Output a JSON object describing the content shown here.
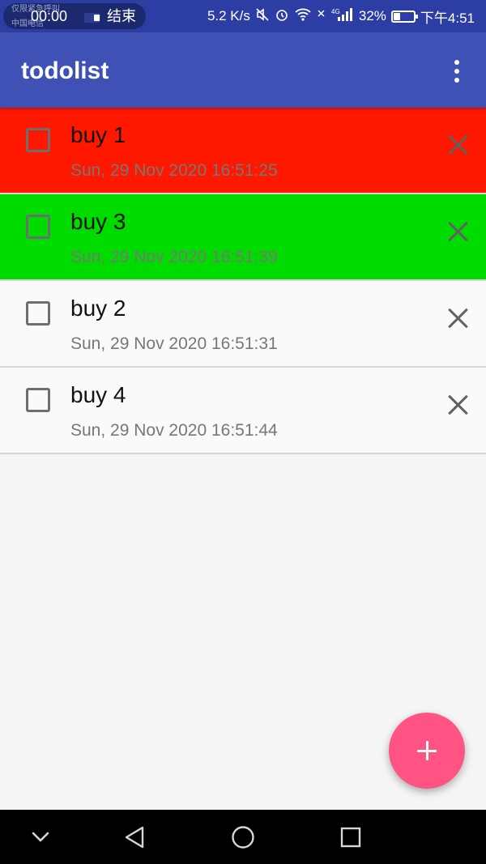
{
  "status_bar": {
    "carrier_line1": "仅限紧急呼叫",
    "carrier_line2": "中国电信",
    "call_timer": "00:00",
    "call_end_label": "结束",
    "net_speed": "5.2 K/s",
    "network_label": "4G",
    "battery_percent": "32%",
    "battery_level": 0.32,
    "time": "下午4:51"
  },
  "app_bar": {
    "title": "todolist"
  },
  "todos": [
    {
      "title": "buy 1",
      "date": "Sun, 29 Nov 2020 16:51:25",
      "bg": "#ff1800",
      "checked": false
    },
    {
      "title": "buy 3",
      "date": "Sun, 29 Nov 2020 16:51:39",
      "bg": "#00db00",
      "checked": false
    },
    {
      "title": "buy 2",
      "date": "Sun, 29 Nov 2020 16:51:31",
      "bg": "#fafafa",
      "checked": false
    },
    {
      "title": "buy 4",
      "date": "Sun, 29 Nov 2020 16:51:44",
      "bg": "#fafafa",
      "checked": false
    }
  ],
  "colors": {
    "app_bar": "#3f51b5",
    "status_bar": "#2c3ea3",
    "fab": "#ff5383"
  },
  "icons": {
    "overflow": "more-vert-icon",
    "delete": "close-icon",
    "fab": "add-icon",
    "nav_collapse": "chevron-down-icon",
    "nav_back": "back-triangle-icon",
    "nav_home": "home-circle-icon",
    "nav_recents": "recents-square-icon"
  }
}
